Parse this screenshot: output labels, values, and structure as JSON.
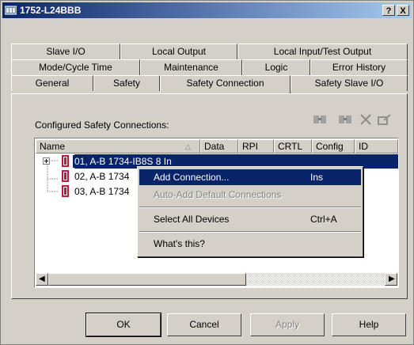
{
  "window": {
    "title": "1752-L24BBB",
    "help_btn": "?",
    "close_btn": "X"
  },
  "tabs": {
    "row1": [
      "Slave I/O",
      "Local Output",
      "Local Input/Test Output"
    ],
    "row2": [
      "Mode/Cycle Time",
      "Maintenance",
      "Logic",
      "Error History"
    ],
    "row3": [
      "General",
      "Safety",
      "Safety Connection",
      "Safety Slave I/O"
    ],
    "active": "Safety Connection"
  },
  "panel": {
    "configured_label": "Configured Safety Connections:",
    "toolbar_icons": [
      "connection-edit-icon",
      "connection-add-icon",
      "delete-x-icon",
      "properties-icon"
    ]
  },
  "list": {
    "columns": [
      "Name",
      "Data",
      "RPI",
      "CRTL",
      "Config",
      "ID"
    ],
    "rows": [
      {
        "label": "01, A-B 1734-IB8S 8 In",
        "selected": true
      },
      {
        "label": "02, A-B 1734",
        "selected": false
      },
      {
        "label": "03, A-B 1734",
        "selected": false
      }
    ]
  },
  "context_menu": {
    "items": [
      {
        "label": "Add Connection...",
        "shortcut": "Ins",
        "state": "highlighted"
      },
      {
        "label": "Auto-Add Default Connections",
        "shortcut": "",
        "state": "disabled"
      },
      {
        "label": "Select All Devices",
        "shortcut": "Ctrl+A",
        "state": "normal"
      },
      {
        "label": "What's this?",
        "shortcut": "",
        "state": "normal"
      }
    ]
  },
  "buttons": {
    "ok": "OK",
    "cancel": "Cancel",
    "apply": "Apply",
    "help": "Help"
  },
  "colors": {
    "selection": "#0a246a",
    "face": "#d4d0c8",
    "device_icon": "#c0183c"
  }
}
